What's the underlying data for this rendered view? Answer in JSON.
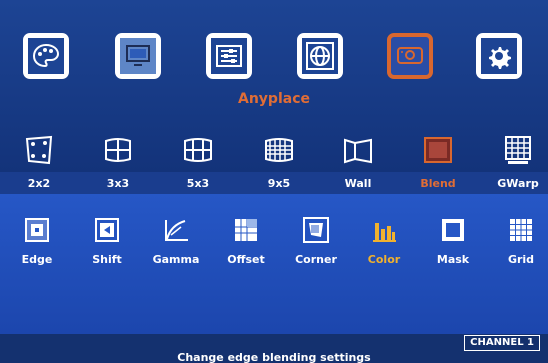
{
  "menu": {
    "title": "Anyplace"
  },
  "top_tabs": [
    {
      "icon": "palette-icon"
    },
    {
      "icon": "monitor-layout-icon"
    },
    {
      "icon": "equalizer-icon"
    },
    {
      "icon": "globe-icon"
    },
    {
      "icon": "projector-icon"
    },
    {
      "icon": "gear-icon"
    }
  ],
  "modes": [
    {
      "label": "2x2"
    },
    {
      "label": "3x3"
    },
    {
      "label": "5x3"
    },
    {
      "label": "9x5"
    },
    {
      "label": "Wall"
    },
    {
      "label": "Blend"
    },
    {
      "label": "GWarp"
    }
  ],
  "submenu": [
    {
      "label": "Edge"
    },
    {
      "label": "Shift"
    },
    {
      "label": "Gamma"
    },
    {
      "label": "Offset"
    },
    {
      "label": "Corner"
    },
    {
      "label": "Color"
    },
    {
      "label": "Mask"
    },
    {
      "label": "Grid"
    }
  ],
  "status": {
    "message": "Change edge blending settings",
    "channel": "CHANNEL 1"
  },
  "colors": {
    "selected_mode": "#e06d36",
    "selected_sub": "#f0b12e",
    "panel": "#2657c6"
  }
}
